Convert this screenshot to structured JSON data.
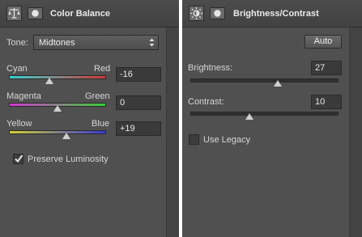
{
  "color_balance": {
    "title": "Color Balance",
    "tone_label": "Tone:",
    "tone_value": "Midtones",
    "sliders": [
      {
        "left": "Cyan",
        "right": "Red",
        "value": "-16",
        "level": -16,
        "colors": [
          "#39d1d1",
          "#d13939"
        ]
      },
      {
        "left": "Magenta",
        "right": "Green",
        "value": "0",
        "level": 0,
        "colors": [
          "#d137d1",
          "#37d137"
        ]
      },
      {
        "left": "Yellow",
        "right": "Blue",
        "value": "+19",
        "level": 19,
        "colors": [
          "#d1d137",
          "#3737d1"
        ]
      }
    ],
    "preserve_luminosity": {
      "label": "Preserve Luminosity",
      "checked": true
    }
  },
  "brightness_contrast": {
    "title": "Brightness/Contrast",
    "auto_label": "Auto",
    "brightness": {
      "label": "Brightness:",
      "value": "27",
      "level": 27
    },
    "contrast": {
      "label": "Contrast:",
      "value": "10",
      "level": 10
    },
    "use_legacy": {
      "label": "Use Legacy",
      "checked": false
    }
  }
}
